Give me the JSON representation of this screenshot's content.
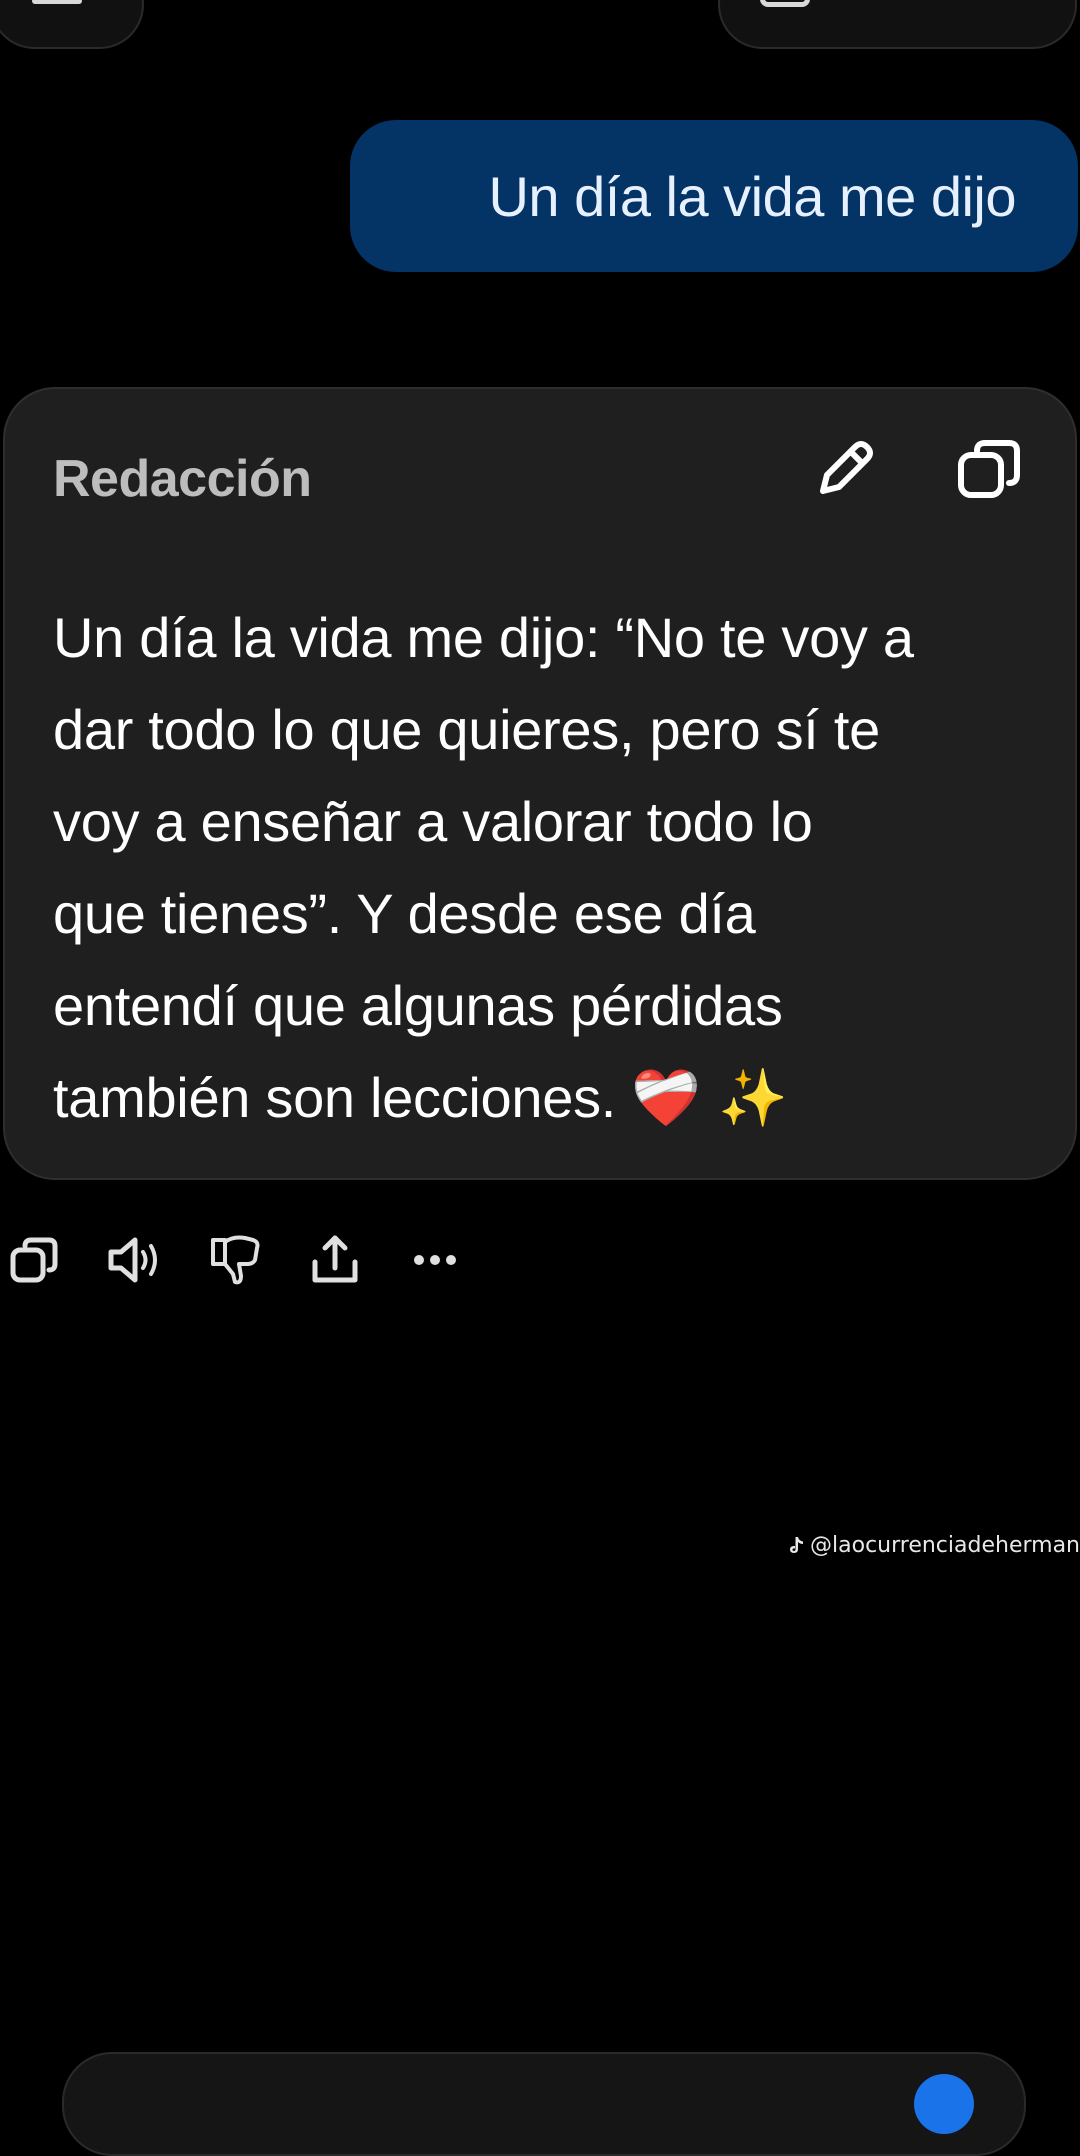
{
  "user_message": {
    "text": "Un día la vida me dijo"
  },
  "response_card": {
    "title": "Redacción",
    "body_lines": [
      "Un día la vida me dijo: “No te voy a",
      "dar todo lo que quieres, pero sí te",
      "voy a enseñar a valorar todo lo",
      "que tienes”. Y desde ese día",
      "entendí que algunas pérdidas",
      "también son lecciones."
    ],
    "emojis": "❤️‍🩹 ✨",
    "icons": {
      "edit": "pencil-icon",
      "copy": "copy-icon"
    }
  },
  "actions": [
    {
      "icon": "copy-icon"
    },
    {
      "icon": "speaker-icon"
    },
    {
      "icon": "thumbs-down-icon"
    },
    {
      "icon": "share-icon"
    },
    {
      "icon": "more-icon"
    }
  ],
  "watermark": {
    "handle": "@laocurrenciadeherman"
  },
  "colors": {
    "background": "#000000",
    "user_bubble": "#043365",
    "card": "#1f1f1f",
    "title": "#bdbdbd",
    "accent": "#1a73e8"
  }
}
